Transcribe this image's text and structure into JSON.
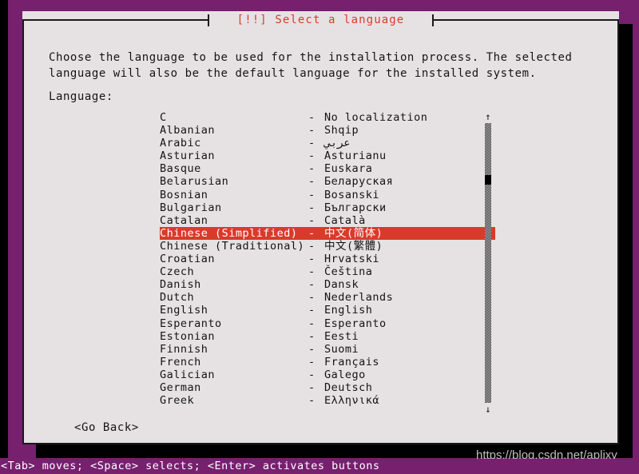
{
  "colors": {
    "desktop_purple": "#76206e",
    "panel_bg": "#e6e2e4",
    "panel_border": "#1a1a1a",
    "title_red": "#d93b2b",
    "highlight_bg": "#d93b2b",
    "highlight_fg": "#ffffff",
    "shadow_black": "#000000",
    "text": "#141414"
  },
  "dialog": {
    "title": "[!!] Select a language",
    "intro": "Choose the language to be used for the installation process. The selected language will also be the default language for the installed system.",
    "field_label": "Language:",
    "go_back_label": "<Go Back>"
  },
  "list": {
    "separator": "-",
    "selected_index": 9,
    "items": [
      {
        "english": "C",
        "native": "No localization"
      },
      {
        "english": "Albanian",
        "native": "Shqip"
      },
      {
        "english": "Arabic",
        "native": "عربي"
      },
      {
        "english": "Asturian",
        "native": "Asturianu"
      },
      {
        "english": "Basque",
        "native": "Euskara"
      },
      {
        "english": "Belarusian",
        "native": "Беларуская"
      },
      {
        "english": "Bosnian",
        "native": "Bosanski"
      },
      {
        "english": "Bulgarian",
        "native": "Български"
      },
      {
        "english": "Catalan",
        "native": "Català"
      },
      {
        "english": "Chinese (Simplified)",
        "native": "中文(简体)"
      },
      {
        "english": "Chinese (Traditional)",
        "native": "中文(繁體)"
      },
      {
        "english": "Croatian",
        "native": "Hrvatski"
      },
      {
        "english": "Czech",
        "native": "Čeština"
      },
      {
        "english": "Danish",
        "native": "Dansk"
      },
      {
        "english": "Dutch",
        "native": "Nederlands"
      },
      {
        "english": "English",
        "native": "English"
      },
      {
        "english": "Esperanto",
        "native": "Esperanto"
      },
      {
        "english": "Estonian",
        "native": "Eesti"
      },
      {
        "english": "Finnish",
        "native": "Suomi"
      },
      {
        "english": "French",
        "native": "Français"
      },
      {
        "english": "Galician",
        "native": "Galego"
      },
      {
        "english": "German",
        "native": "Deutsch"
      },
      {
        "english": "Greek",
        "native": "Ελληνικά"
      }
    ]
  },
  "scrollbar": {
    "up_arrow": "↑",
    "down_arrow": "↓"
  },
  "status_bar": {
    "text": "<Tab> moves; <Space> selects; <Enter> activates buttons"
  },
  "watermark": {
    "text": "https://blog.csdn.net/aplixy"
  }
}
